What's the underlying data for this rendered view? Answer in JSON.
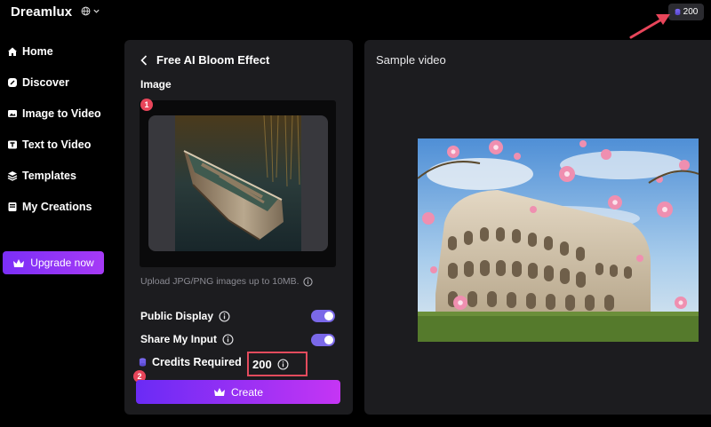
{
  "app": {
    "brand": "Dreamlux",
    "language_icon": "globe-icon"
  },
  "header": {
    "credits_balance": "200"
  },
  "sidebar": {
    "items": [
      {
        "label": "Home",
        "icon": "home-icon"
      },
      {
        "label": "Discover",
        "icon": "discover-icon"
      },
      {
        "label": "Image to Video",
        "icon": "image-to-video-icon"
      },
      {
        "label": "Text to Video",
        "icon": "text-to-video-icon"
      },
      {
        "label": "Templates",
        "icon": "templates-icon"
      },
      {
        "label": "My Creations",
        "icon": "my-creations-icon"
      }
    ],
    "upgrade_label": "Upgrade now"
  },
  "panel": {
    "title": "Free AI Bloom Effect",
    "image_label": "Image",
    "upload_hint": "Upload JPG/PNG images up to 10MB.",
    "step1": "1",
    "step2": "2",
    "public_display_label": "Public Display",
    "public_display_on": true,
    "share_input_label": "Share My Input",
    "share_input_on": true,
    "credits_label": "Credits Required",
    "credits_value": "200",
    "create_label": "Create"
  },
  "preview": {
    "title": "Sample video"
  },
  "colors": {
    "accent": "#7b2ff7",
    "toggle": "#7a68e8",
    "highlight": "#e34b5d",
    "panel": "#1c1c1f"
  }
}
